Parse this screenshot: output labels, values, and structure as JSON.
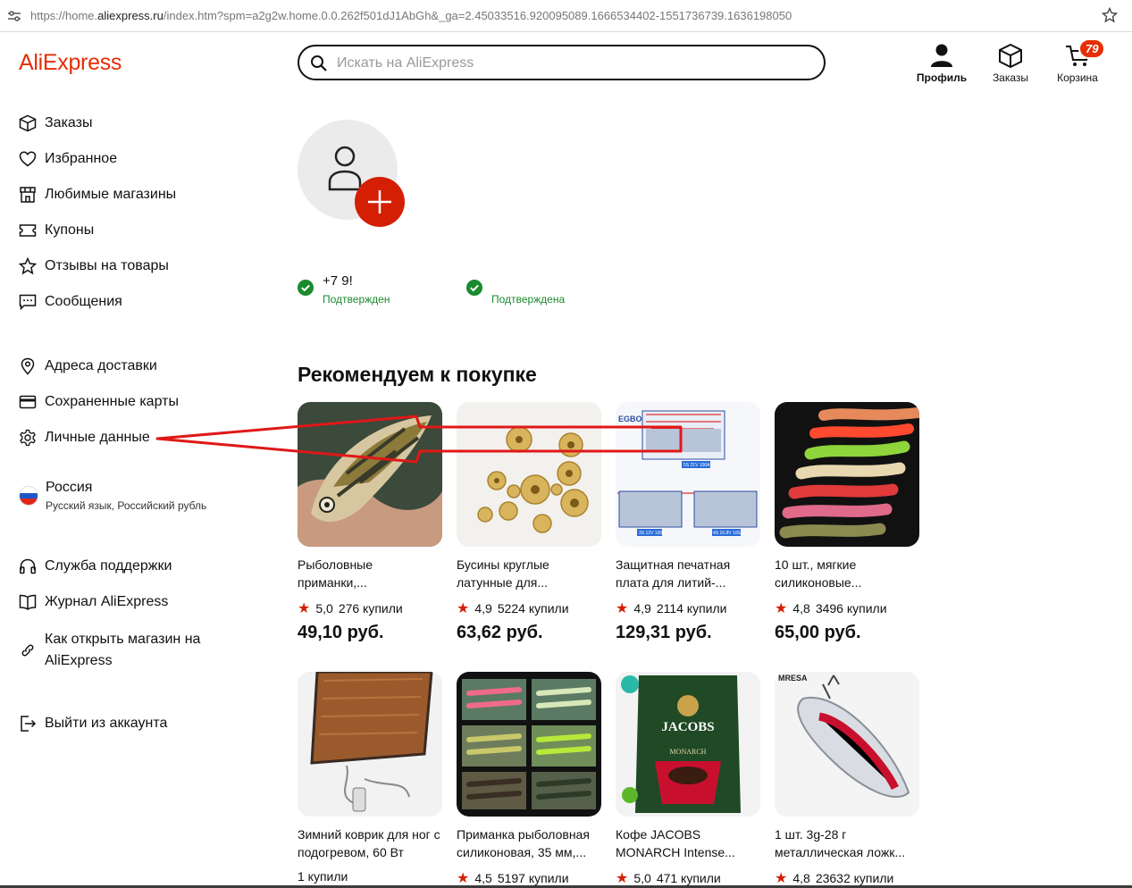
{
  "browser": {
    "url_prefix": "https://home.",
    "url_domain": "aliexpress.ru",
    "url_rest": "/index.htm?spm=a2g2w.home.0.0.262f501dJ1AbGh&_ga=2.45033516.920095089.1666534402-1551736739.1636198050"
  },
  "header": {
    "logo": "AliExpress",
    "search_placeholder": "Искать на AliExpress",
    "profile_label": "Профиль",
    "orders_label": "Заказы",
    "cart_label": "Корзина",
    "cart_count": "79"
  },
  "sidebar": {
    "items": [
      {
        "label": "Заказы",
        "icon": "box-icon"
      },
      {
        "label": "Избранное",
        "icon": "heart-icon"
      },
      {
        "label": "Любимые магазины",
        "icon": "store-icon"
      },
      {
        "label": "Купоны",
        "icon": "coupon-icon"
      },
      {
        "label": "Отзывы на товары",
        "icon": "star-icon"
      },
      {
        "label": "Сообщения",
        "icon": "message-icon"
      }
    ],
    "account_items": [
      {
        "label": "Адреса доставки",
        "icon": "location-pin-icon"
      },
      {
        "label": "Сохраненные карты",
        "icon": "card-icon"
      },
      {
        "label": "Личные данные",
        "icon": "gear-icon"
      }
    ],
    "region": {
      "country": "Россия",
      "details": "Русский язык, Российский рубль"
    },
    "help_items": [
      {
        "label": "Служба поддержки",
        "icon": "headphones-icon"
      },
      {
        "label": "Журнал AliExpress",
        "icon": "book-icon"
      },
      {
        "label": "Как открыть магазин на",
        "label2": "AliExpress",
        "icon": "link-icon"
      }
    ],
    "logout": {
      "label": "Выйти из аккаунта",
      "icon": "logout-icon"
    }
  },
  "profile": {
    "phone": "+7 9!",
    "phone_status": "Подтвержден",
    "email_status": "Подтверждена"
  },
  "recommend": {
    "title": "Рекомендуем к покупке",
    "products": [
      {
        "name": "Рыболовные приманки,...",
        "rating": "5,0",
        "sold": "276 купили",
        "price": "49,10 руб."
      },
      {
        "name": "Бусины круглые латунные для...",
        "rating": "4,9",
        "sold": "5224 купили",
        "price": "63,62 руб."
      },
      {
        "name": "Защитная печатная плата для литий-...",
        "rating": "4,9",
        "sold": "2114 купили",
        "price": "129,31 руб."
      },
      {
        "name": "10 шт., мягкие силиконовые...",
        "rating": "4,8",
        "sold": "3496 купили",
        "price": "65,00 руб."
      },
      {
        "name": "Зимний коврик для ног с подогревом, 60 Вт",
        "rating": "",
        "sold": "1 купили",
        "price": ""
      },
      {
        "name": "Приманка рыболовная силиконовая, 35 мм,...",
        "rating": "4,5",
        "sold": "5197 купили",
        "price": ""
      },
      {
        "name": "Кофе JACOBS MONARCH Intense...",
        "rating": "5,0",
        "sold": "471 купили",
        "price": ""
      },
      {
        "name": "1 шт. 3g-28 г металлическая ложк...",
        "rating": "4,8",
        "sold": "23632 купили",
        "price": ""
      }
    ],
    "image_texts": {
      "pcb_brand": "EGBO",
      "pcb_label1": "5S 21V 100A",
      "pcb_label2": "3S 12V 100A",
      "pcb_label3": "4S 16.8V 100A",
      "coffee_brand": "JACOBS",
      "coffee_sub": "MONARCH",
      "spoon_brand": "MRESA"
    }
  },
  "colors": {
    "accent": "#e62e04",
    "red_button": "#d41f05",
    "verified_green": "#1a8a2e"
  }
}
